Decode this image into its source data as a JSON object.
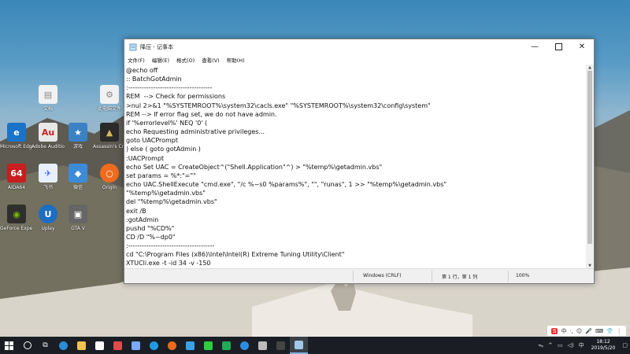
{
  "desktop": {
    "icons": [
      {
        "label": "文档",
        "color": "#f2f2f2"
      },
      {
        "label": "此电脑文件",
        "color": "#f2f2f2"
      },
      {
        "label": "Microsoft Edge",
        "color": "#1a73c8"
      },
      {
        "label": "Adobe Audition",
        "color": "#e7e7e7"
      },
      {
        "label": "游戏",
        "color": "#3b82c4"
      },
      {
        "label": "Assassin's Creed",
        "color": "#2a2a2a"
      },
      {
        "label": "AIDA64",
        "color": "#c81e1e"
      },
      {
        "label": "飞书",
        "color": "#e8f0ff"
      },
      {
        "label": "微信",
        "color": "#3c8bd9"
      },
      {
        "label": "Origin",
        "color": "#f06b1d"
      },
      {
        "label": "GeForce Experience",
        "color": "#2f2f2f"
      },
      {
        "label": "Uplay",
        "color": "#1b6ec2"
      },
      {
        "label": "GTA V",
        "color": "#666666"
      }
    ]
  },
  "notepad": {
    "title": "降压 - 记事本",
    "menu": [
      "文件(F)",
      "编辑(E)",
      "格式(O)",
      "查看(V)",
      "帮助(H)"
    ],
    "lines": [
      "@echo off",
      ":: BatchGotAdmin",
      ":-------------------------------------",
      "REM  --> Check for permissions",
      ">nul 2>&1 \"%SYSTEMROOT%\\system32\\cacls.exe\" \"%SYSTEMROOT%\\system32\\config\\system\"",
      "REM --> If error flag set, we do not have admin.",
      "if '%errorlevel%' NEQ '0' (",
      "echo Requesting administrative privileges...",
      "goto UACPrompt",
      ") else ( goto gotAdmin )",
      ":UACPrompt",
      "echo Set UAC = CreateObject^(\"Shell.Application\"^) > \"%temp%\\getadmin.vbs\"",
      "set params = %*:\"=\"\"",
      "echo UAC.ShellExecute \"cmd.exe\", \"/c %~s0 %params%\", \"\", \"runas\", 1 >> \"%temp%\\getadmin.vbs\"",
      "\"%temp%\\getadmin.vbs\"",
      "del \"%temp%\\getadmin.vbs\"",
      "exit /B",
      ":gotAdmin",
      "pushd \"%CD%\"",
      "CD /D \"%~dp0\"",
      ":--------------------------------------",
      "cd \"C:\\Program Files (x86)\\Intel\\Intel(R) Extreme Tuning Utility\\Client\"",
      "XTUCli.exe -t -id 34 -v -150"
    ],
    "status": {
      "encoding": "Windows (CRLF)",
      "position": "第 1 行，第 1 列",
      "zoom": "100%"
    }
  },
  "taskbar": {
    "apps": [
      {
        "name": "start",
        "color": "#ffffff"
      },
      {
        "name": "search",
        "color": "#ffffff"
      },
      {
        "name": "task-view",
        "color": "#ffffff"
      },
      {
        "name": "edge",
        "color": "#2a8bd8"
      },
      {
        "name": "file-explorer",
        "color": "#f2c14e"
      },
      {
        "name": "store",
        "color": "#ffffff"
      },
      {
        "name": "photos",
        "color": "#e24b4b"
      },
      {
        "name": "feishu",
        "color": "#7aa7ff"
      },
      {
        "name": "browser",
        "color": "#1f9be6"
      },
      {
        "name": "origin",
        "color": "#f06b1d"
      },
      {
        "name": "app-blue",
        "color": "#3ba0e8"
      },
      {
        "name": "wechat",
        "color": "#2ecc40"
      },
      {
        "name": "app-green",
        "color": "#22aa55"
      },
      {
        "name": "app-circle",
        "color": "#2d8ce0"
      },
      {
        "name": "app-dark",
        "color": "#bbbbbb"
      },
      {
        "name": "app-black",
        "color": "#444444"
      },
      {
        "name": "notepad",
        "color": "#9fc8e8"
      }
    ],
    "ime": [
      "S",
      "中",
      "·,",
      "☺",
      "🎤",
      "⌨",
      "👕",
      "⋮"
    ],
    "tray": [
      "^",
      "中"
    ],
    "time": "18:12",
    "date": "2019/5/20"
  }
}
